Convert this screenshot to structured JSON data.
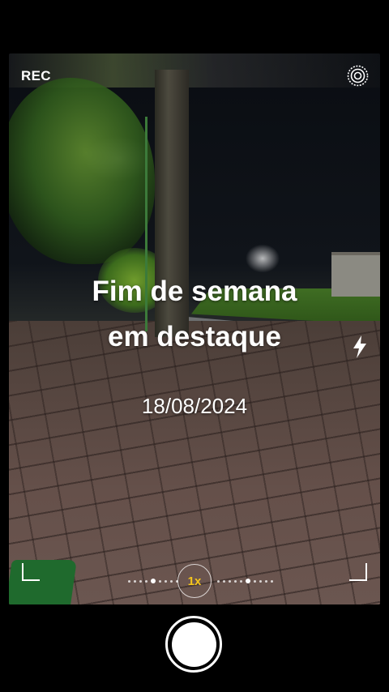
{
  "status": {
    "rec_label": "REC"
  },
  "overlay": {
    "caption_line1": "Fim de semana",
    "caption_line2": "em destaque",
    "date": "18/08/2024"
  },
  "zoom": {
    "label": "1x",
    "accent_color": "#f4c51c"
  },
  "icons": {
    "settings": "settings-icon",
    "flash": "flash-icon",
    "shutter": "shutter-button"
  }
}
